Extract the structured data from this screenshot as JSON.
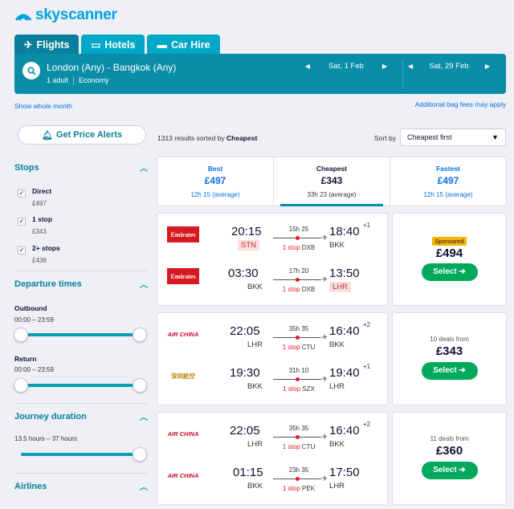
{
  "brand": {
    "name": "skyscanner"
  },
  "tabs": [
    {
      "label": "Flights",
      "icon": "plane-icon"
    },
    {
      "label": "Hotels",
      "icon": "bed-icon"
    },
    {
      "label": "Car Hire",
      "icon": "car-icon"
    }
  ],
  "search": {
    "route": "London (Any) - Bangkok (Any)",
    "passengers": "1 adult",
    "cabin": "Economy",
    "depart_date": "Sat, 1 Feb",
    "return_date": "Sat, 29 Feb"
  },
  "links": {
    "whole_month": "Show whole month",
    "bag_fees": "Additional bag fees may apply"
  },
  "sidebar": {
    "price_alerts": "Get Price Alerts",
    "stops_title": "Stops",
    "stops": [
      {
        "label": "Direct",
        "price": "£497",
        "checked": "✓"
      },
      {
        "label": "1 stop",
        "price": "£343",
        "checked": "✓"
      },
      {
        "label": "2+ stops",
        "price": "£438",
        "checked": "✓"
      }
    ],
    "departure_title": "Departure times",
    "outbound_label": "Outbound",
    "outbound_range": "00:00 – 23:59",
    "return_label": "Return",
    "return_range": "00:00 – 23:59",
    "duration_title": "Journey duration",
    "duration_range": "13.5 hours – 37 hours",
    "airlines_title": "Airlines"
  },
  "results": {
    "count_prefix": "1313 results sorted by",
    "count_sort": "Cheapest",
    "sort_label": "Sort by",
    "sort_value": "Cheapest first"
  },
  "summary": [
    {
      "title": "Best",
      "price": "£497",
      "avg": "12h 15 (average)"
    },
    {
      "title": "Cheapest",
      "price": "£343",
      "avg": "33h 23 (average)"
    },
    {
      "title": "Fastest",
      "price": "£497",
      "avg": "12h 15 (average)"
    }
  ],
  "cards": [
    {
      "legs": [
        {
          "airline": "Emirates",
          "dep": "20:15",
          "dep_ap": "STN",
          "dur": "15h 25",
          "stops": "1 stop",
          "via": "DXB",
          "arr": "18:40",
          "plus": "+1",
          "arr_ap": "BKK"
        },
        {
          "airline": "Emirates",
          "dep": "03:30",
          "dep_ap": "BKK",
          "dur": "17h 20",
          "stops": "1 stop",
          "via": "DXB",
          "arr": "13:50",
          "plus": "",
          "arr_ap": "LHR"
        }
      ],
      "badge": "Sponsored",
      "deals": "",
      "price": "£494",
      "select": "Select ➔"
    },
    {
      "legs": [
        {
          "airline": "AIR CHINA",
          "dep": "22:05",
          "dep_ap": "LHR",
          "dur": "35h 35",
          "stops": "1 stop",
          "via": "CTU",
          "arr": "16:40",
          "plus": "+2",
          "arr_ap": "BKK"
        },
        {
          "airline": "深圳航空",
          "dep": "19:30",
          "dep_ap": "BKK",
          "dur": "31h 10",
          "stops": "1 stop",
          "via": "SZX",
          "arr": "19:40",
          "plus": "+1",
          "arr_ap": "LHR"
        }
      ],
      "badge": "",
      "deals": "10 deals from",
      "price": "£343",
      "select": "Select ➔"
    },
    {
      "legs": [
        {
          "airline": "AIR CHINA",
          "dep": "22:05",
          "dep_ap": "LHR",
          "dur": "35h 35",
          "stops": "1 stop",
          "via": "CTU",
          "arr": "16:40",
          "plus": "+2",
          "arr_ap": "BKK"
        },
        {
          "airline": "AIR CHINA",
          "dep": "01:15",
          "dep_ap": "BKK",
          "dur": "23h 35",
          "stops": "1 stop",
          "via": "PEK",
          "arr": "17:50",
          "plus": "",
          "arr_ap": "LHR"
        }
      ],
      "badge": "",
      "deals": "11 deals from",
      "price": "£360",
      "select": "Select ➔"
    }
  ]
}
